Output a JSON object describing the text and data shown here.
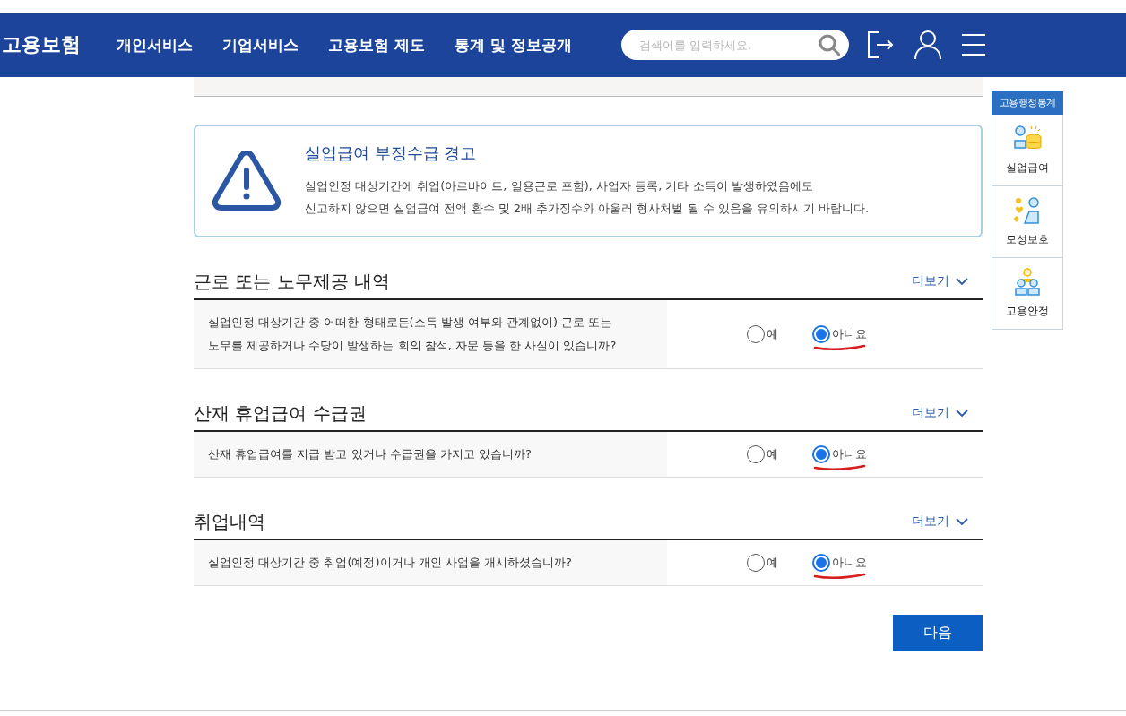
{
  "header": {
    "logo": "고용보험",
    "nav": [
      "개인서비스",
      "기업서비스",
      "고용보험 제도",
      "통계 및 정보공개"
    ],
    "search": {
      "placeholder": "검색어를 입력하세요."
    }
  },
  "alert": {
    "title": "실업급여 부정수급 경고",
    "lines": [
      "실업인정 대상기간에 취업(아르바이트, 일용근로 포함), 사업자 등록, 기타 소득이 발생하였음에도",
      "신고하지 않으면 실업급여 전액 환수 및 2배 추가징수와 아울러 형사처벌 될 수 있음을 유의하시기 바랍니다."
    ]
  },
  "sections": [
    {
      "title": "근로 또는 노무제공 내역",
      "more": "더보기",
      "question": {
        "lines": [
          "실업인정 대상기간 중 어떠한 형태로든(소득 발생 여부와 관계없이) 근로 또는",
          "노무를 제공하거나 수당이 발생하는 회의 참석, 자문 등을 한 사실이 있습니까?"
        ],
        "options": [
          {
            "label": "예",
            "selected": false,
            "underlined": false
          },
          {
            "label": "아니요",
            "selected": true,
            "underlined": true
          }
        ]
      }
    },
    {
      "title": "산재 휴업급여 수급권",
      "more": "더보기",
      "question": {
        "lines": [
          "산재 휴업급여를 지급 받고 있거나 수급권을 가지고 있습니까?"
        ],
        "options": [
          {
            "label": "예",
            "selected": false,
            "underlined": false
          },
          {
            "label": "아니요",
            "selected": true,
            "underlined": true
          }
        ]
      }
    },
    {
      "title": "취업내역",
      "more": "더보기",
      "question": {
        "lines": [
          "실업인정 대상기간 중 취업(예정)이거나 개인 사업을 개시하셨습니까?"
        ],
        "options": [
          {
            "label": "예",
            "selected": false,
            "underlined": false
          },
          {
            "label": "아니요",
            "selected": true,
            "underlined": true
          }
        ]
      }
    }
  ],
  "next_button": "다음",
  "side_panel": {
    "title": "고용행정통계",
    "items": [
      {
        "label": "실업급여",
        "kind": "benefit"
      },
      {
        "label": "모성보호",
        "kind": "maternity"
      },
      {
        "label": "고용안정",
        "kind": "stability"
      }
    ]
  }
}
